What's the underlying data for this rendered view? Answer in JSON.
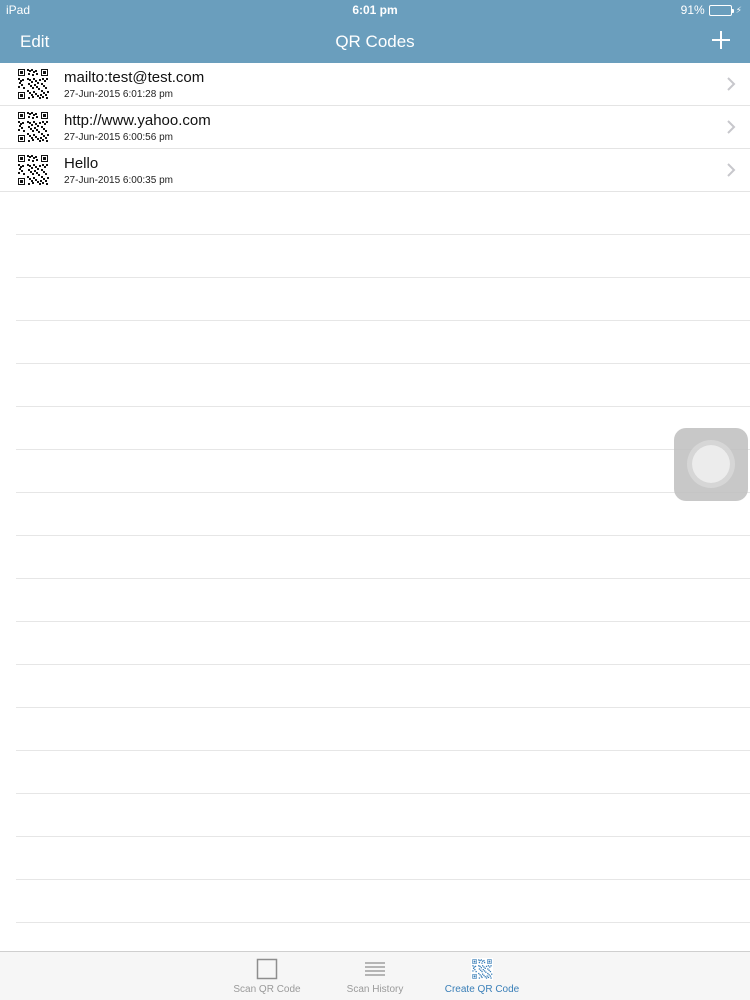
{
  "status_bar": {
    "device": "iPad",
    "time": "6:01 pm",
    "battery": "91%",
    "battery_level": 0.91
  },
  "nav": {
    "edit_label": "Edit",
    "title": "QR Codes",
    "add_icon": "plus-icon"
  },
  "items": [
    {
      "title": "mailto:test@test.com",
      "timestamp": "27-Jun-2015 6:01:28 pm"
    },
    {
      "title": "http://www.yahoo.com",
      "timestamp": "27-Jun-2015 6:00:56 pm"
    },
    {
      "title": "Hello",
      "timestamp": "27-Jun-2015 6:00:35 pm"
    }
  ],
  "tabs": [
    {
      "label": "Scan QR Code",
      "icon": "square-icon",
      "active": false
    },
    {
      "label": "Scan History",
      "icon": "list-icon",
      "active": false
    },
    {
      "label": "Create QR Code",
      "icon": "qr-code-icon",
      "active": true
    }
  ],
  "colors": {
    "nav_bg": "#6a9ebd",
    "active_tab": "#3a7fb8",
    "inactive_tab": "#9a9a9a"
  }
}
